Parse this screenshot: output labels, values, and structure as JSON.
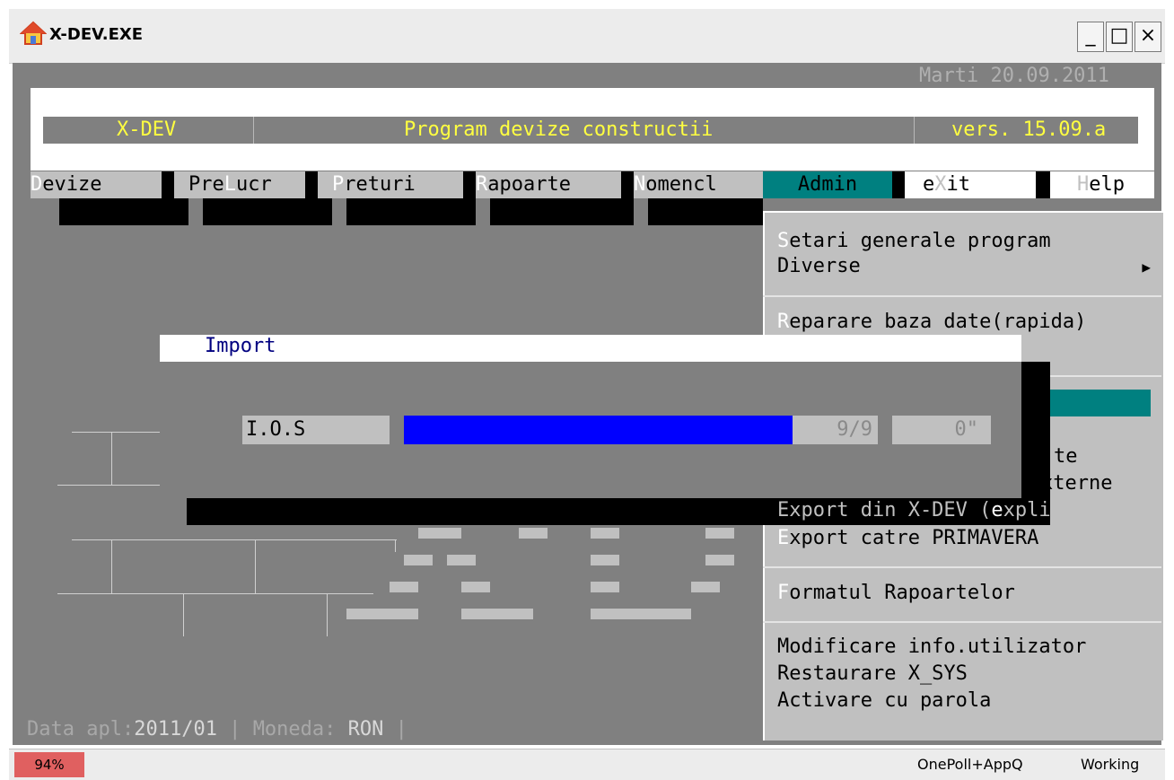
{
  "window": {
    "title": "X-DEV.EXE",
    "controls": [
      "_",
      "□",
      "×"
    ]
  },
  "header": {
    "date": "Marti 20.09.2011",
    "app_name": "X-DEV",
    "app_title": "Program devize constructii",
    "version": "vers. 15.09.a"
  },
  "menu": [
    {
      "hot": "D",
      "rest": "evize"
    },
    {
      "pre": "Pre",
      "hot": "L",
      "rest": "ucr"
    },
    {
      "hot": "P",
      "rest": "returi"
    },
    {
      "hot": "R",
      "rest": "apoarte"
    },
    {
      "hot": "N",
      "rest": "omencl"
    },
    {
      "label": "Admin"
    },
    {
      "pre": "e",
      "hot": "X",
      "rest": "it"
    },
    {
      "hot": "H",
      "rest": "elp"
    }
  ],
  "dropdown": {
    "items": [
      {
        "hot": "S",
        "rest": "etari generale program"
      },
      {
        "label": "Diverse",
        "submenu_arrow": "▶"
      },
      {
        "hot": "R",
        "rest": "eparare baza date(rapida)"
      },
      {
        "label": "te"
      },
      {
        "label": "xterne"
      },
      {
        "label": "Export din X-DEV (",
        "hot": "e",
        "rest": "xplic.)"
      },
      {
        "hot": "E",
        "rest": "xport catre PRIMAVERA"
      },
      {
        "hot": "F",
        "rest": "ormatul Rapoartelor"
      },
      {
        "label": "Modificare info.utilizator"
      },
      {
        "label": "Restaurare X_SYS"
      },
      {
        "label": "Activare cu parola"
      }
    ]
  },
  "import_dialog": {
    "title": "Import",
    "field_label": "I.O.S",
    "progress_fraction": 0.82,
    "progress_count": "9/9",
    "elapsed": "0\""
  },
  "footer": {
    "data_label": "Data apl:",
    "data_value": "2011/01",
    "sep1": " | ",
    "moneda_label": "Moneda: ",
    "moneda_value": "RON",
    "sep2": " |"
  },
  "statusbar": {
    "percent": "94%",
    "app": "OnePoll+AppQ",
    "state": "Working"
  },
  "colors": {
    "console_bg": "#808080",
    "header_text": "#ffff40",
    "menu_active": "#008080",
    "progress": "#0000ff",
    "percent_bg": "#e06060"
  }
}
